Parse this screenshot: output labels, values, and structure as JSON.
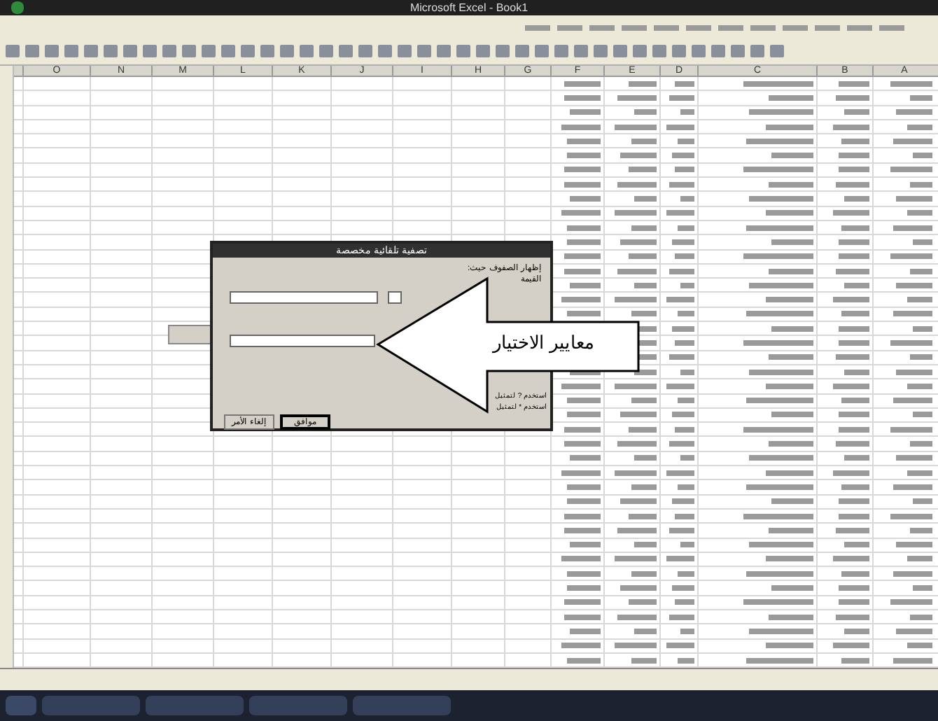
{
  "window": {
    "title": "Microsoft Excel - Book1"
  },
  "columns": [
    "A",
    "B",
    "C",
    "D",
    "E",
    "F",
    "G",
    "H",
    "I",
    "J",
    "K",
    "L",
    "M",
    "N",
    "O"
  ],
  "dialog": {
    "title": "تصفية تلقائية مخصصة",
    "heading": "إظهار الصفوف حيث:",
    "field_label": "القيمة",
    "hints": [
      "استخدم ? لتمثيل",
      "استخدم * لتمثيل"
    ],
    "buttons": [
      {
        "label": "موافق",
        "kind": "default"
      },
      {
        "label": "إلغاء الأمر",
        "kind": "normal"
      }
    ]
  },
  "callout": {
    "text": "معايير الاختيار"
  }
}
